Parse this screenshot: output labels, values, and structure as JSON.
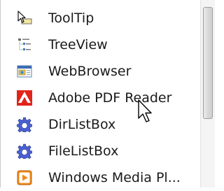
{
  "toolbox": {
    "items": [
      {
        "label": "ToolTip",
        "icon": "tooltip-icon"
      },
      {
        "label": "TreeView",
        "icon": "treeview-icon"
      },
      {
        "label": "WebBrowser",
        "icon": "webbrowser-icon"
      },
      {
        "label": "Adobe PDF Reader",
        "icon": "adobe-pdf-icon"
      },
      {
        "label": "DirListBox",
        "icon": "gear-icon"
      },
      {
        "label": "FileListBox",
        "icon": "gear-icon"
      },
      {
        "label": "Windows Media Pl...",
        "icon": "media-player-icon"
      }
    ]
  },
  "colors": {
    "text": "#1a1a1a",
    "background": "#ffffff",
    "adobe_red": "#e2231a",
    "gear_blue": "#4a5fd0",
    "media_orange": "#f08a1c"
  }
}
